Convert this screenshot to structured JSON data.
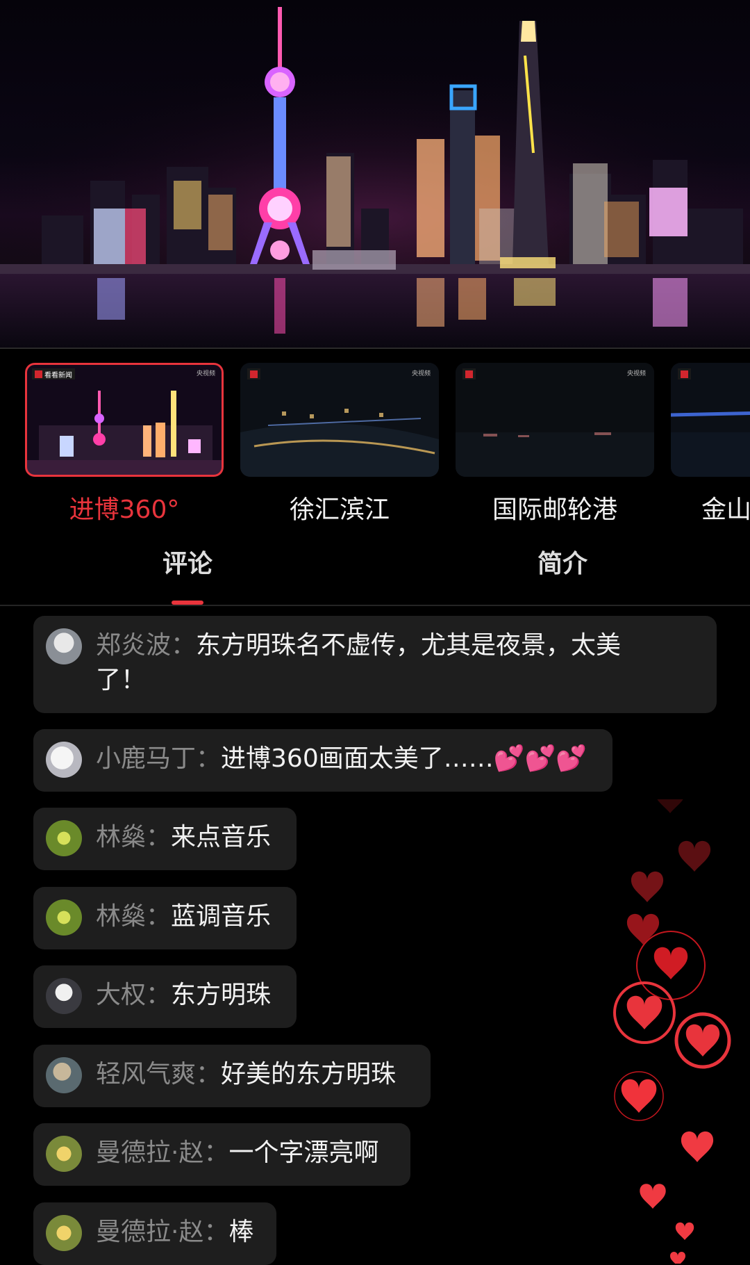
{
  "player": {
    "scene": "night-skyline"
  },
  "cameras": [
    {
      "label": "进博360°",
      "active": true,
      "badge": "看看新闻",
      "watermark": "央视频"
    },
    {
      "label": "徐汇滨江",
      "active": false,
      "badge": "",
      "watermark": "央视频"
    },
    {
      "label": "国际邮轮港",
      "active": false,
      "badge": "",
      "watermark": "央视频"
    },
    {
      "label": "金山",
      "active": false,
      "badge": "",
      "watermark": ""
    }
  ],
  "tabs": [
    {
      "label": "评论",
      "active": true
    },
    {
      "label": "简介",
      "active": false
    }
  ],
  "comments": [
    {
      "user": "郑炎波：",
      "text": "东方明珠名不虚传，尤其是夜景，太美了！"
    },
    {
      "user": "小鹿马丁：",
      "text": "进博360画面太美了……💕💕💕"
    },
    {
      "user": "林燊：",
      "text": "来点音乐"
    },
    {
      "user": "林燊：",
      "text": "蓝调音乐"
    },
    {
      "user": "大权：",
      "text": "东方明珠"
    },
    {
      "user": "轻风气爽：",
      "text": "好美的东方明珠"
    },
    {
      "user": "曼德拉·赵：",
      "text": "一个字漂亮啊"
    },
    {
      "user": "曼德拉·赵：",
      "text": "棒"
    }
  ],
  "colors": {
    "accent": "#e8343c",
    "background": "#000000",
    "bubble": "#1e1e1e",
    "username": "#8a8a8a"
  },
  "icons": {
    "like": "heart-icon"
  }
}
